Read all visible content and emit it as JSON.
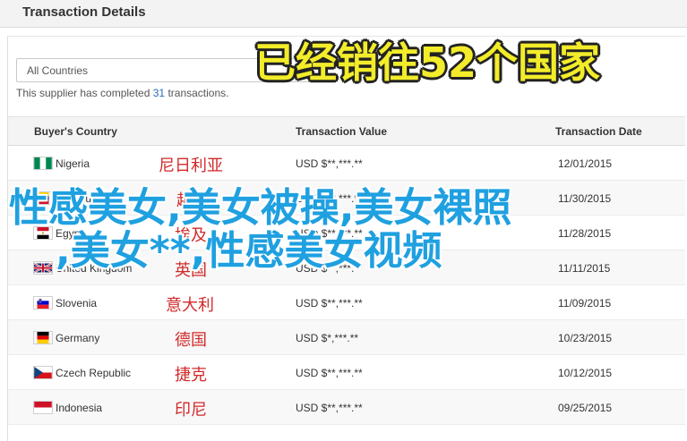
{
  "header": {
    "title": "Transaction Details"
  },
  "filter": {
    "selected": "All Countries"
  },
  "summary": {
    "prefix": "This supplier has completed ",
    "count": "31",
    "suffix": " transactions."
  },
  "table": {
    "columns": [
      "Buyer's Country",
      "Transaction Value",
      "Transaction Date"
    ],
    "rows": [
      {
        "flag": "nigeria-flag",
        "country": "Nigeria",
        "value": "USD $**,***.**",
        "date": "12/01/2015",
        "cn": "尼日利亚"
      },
      {
        "flag": "venezuela-flag",
        "country": "Venezuela",
        "value": "USD $**,***.**",
        "date": "11/30/2015",
        "cn": "越南"
      },
      {
        "flag": "egypt-flag",
        "country": "Egypt",
        "value": "USD $**,***.**",
        "date": "11/28/2015",
        "cn": "埃及"
      },
      {
        "flag": "uk-flag",
        "country": "United Kingdom",
        "value": "USD $**,***.**",
        "date": "11/11/2015",
        "cn": "英国"
      },
      {
        "flag": "slovenia-flag",
        "country": "Slovenia",
        "value": "USD $**,***.**",
        "date": "11/09/2015",
        "cn": "意大利"
      },
      {
        "flag": "germany-flag",
        "country": "Germany",
        "value": "USD $*,***.**",
        "date": "10/23/2015",
        "cn": "德国"
      },
      {
        "flag": "czech-flag",
        "country": "Czech Republic",
        "value": "USD $**,***.**",
        "date": "10/12/2015",
        "cn": "捷克"
      },
      {
        "flag": "indonesia-flag",
        "country": "Indonesia",
        "value": "USD $**,***.**",
        "date": "09/25/2015",
        "cn": "印尼"
      }
    ]
  },
  "overlay": {
    "yellow": "已经销往52个国家",
    "line1": "性感美女,美女被操,美女裸照",
    "line2": ",美女**,性感美女视频"
  },
  "colors": {
    "header_bg": "#f3f3f3",
    "accent_link": "#2a6ab8",
    "cn_red": "#d22a2a",
    "banner_blue": "#1fa0e0",
    "banner_yellow": "#f2ec2a"
  }
}
